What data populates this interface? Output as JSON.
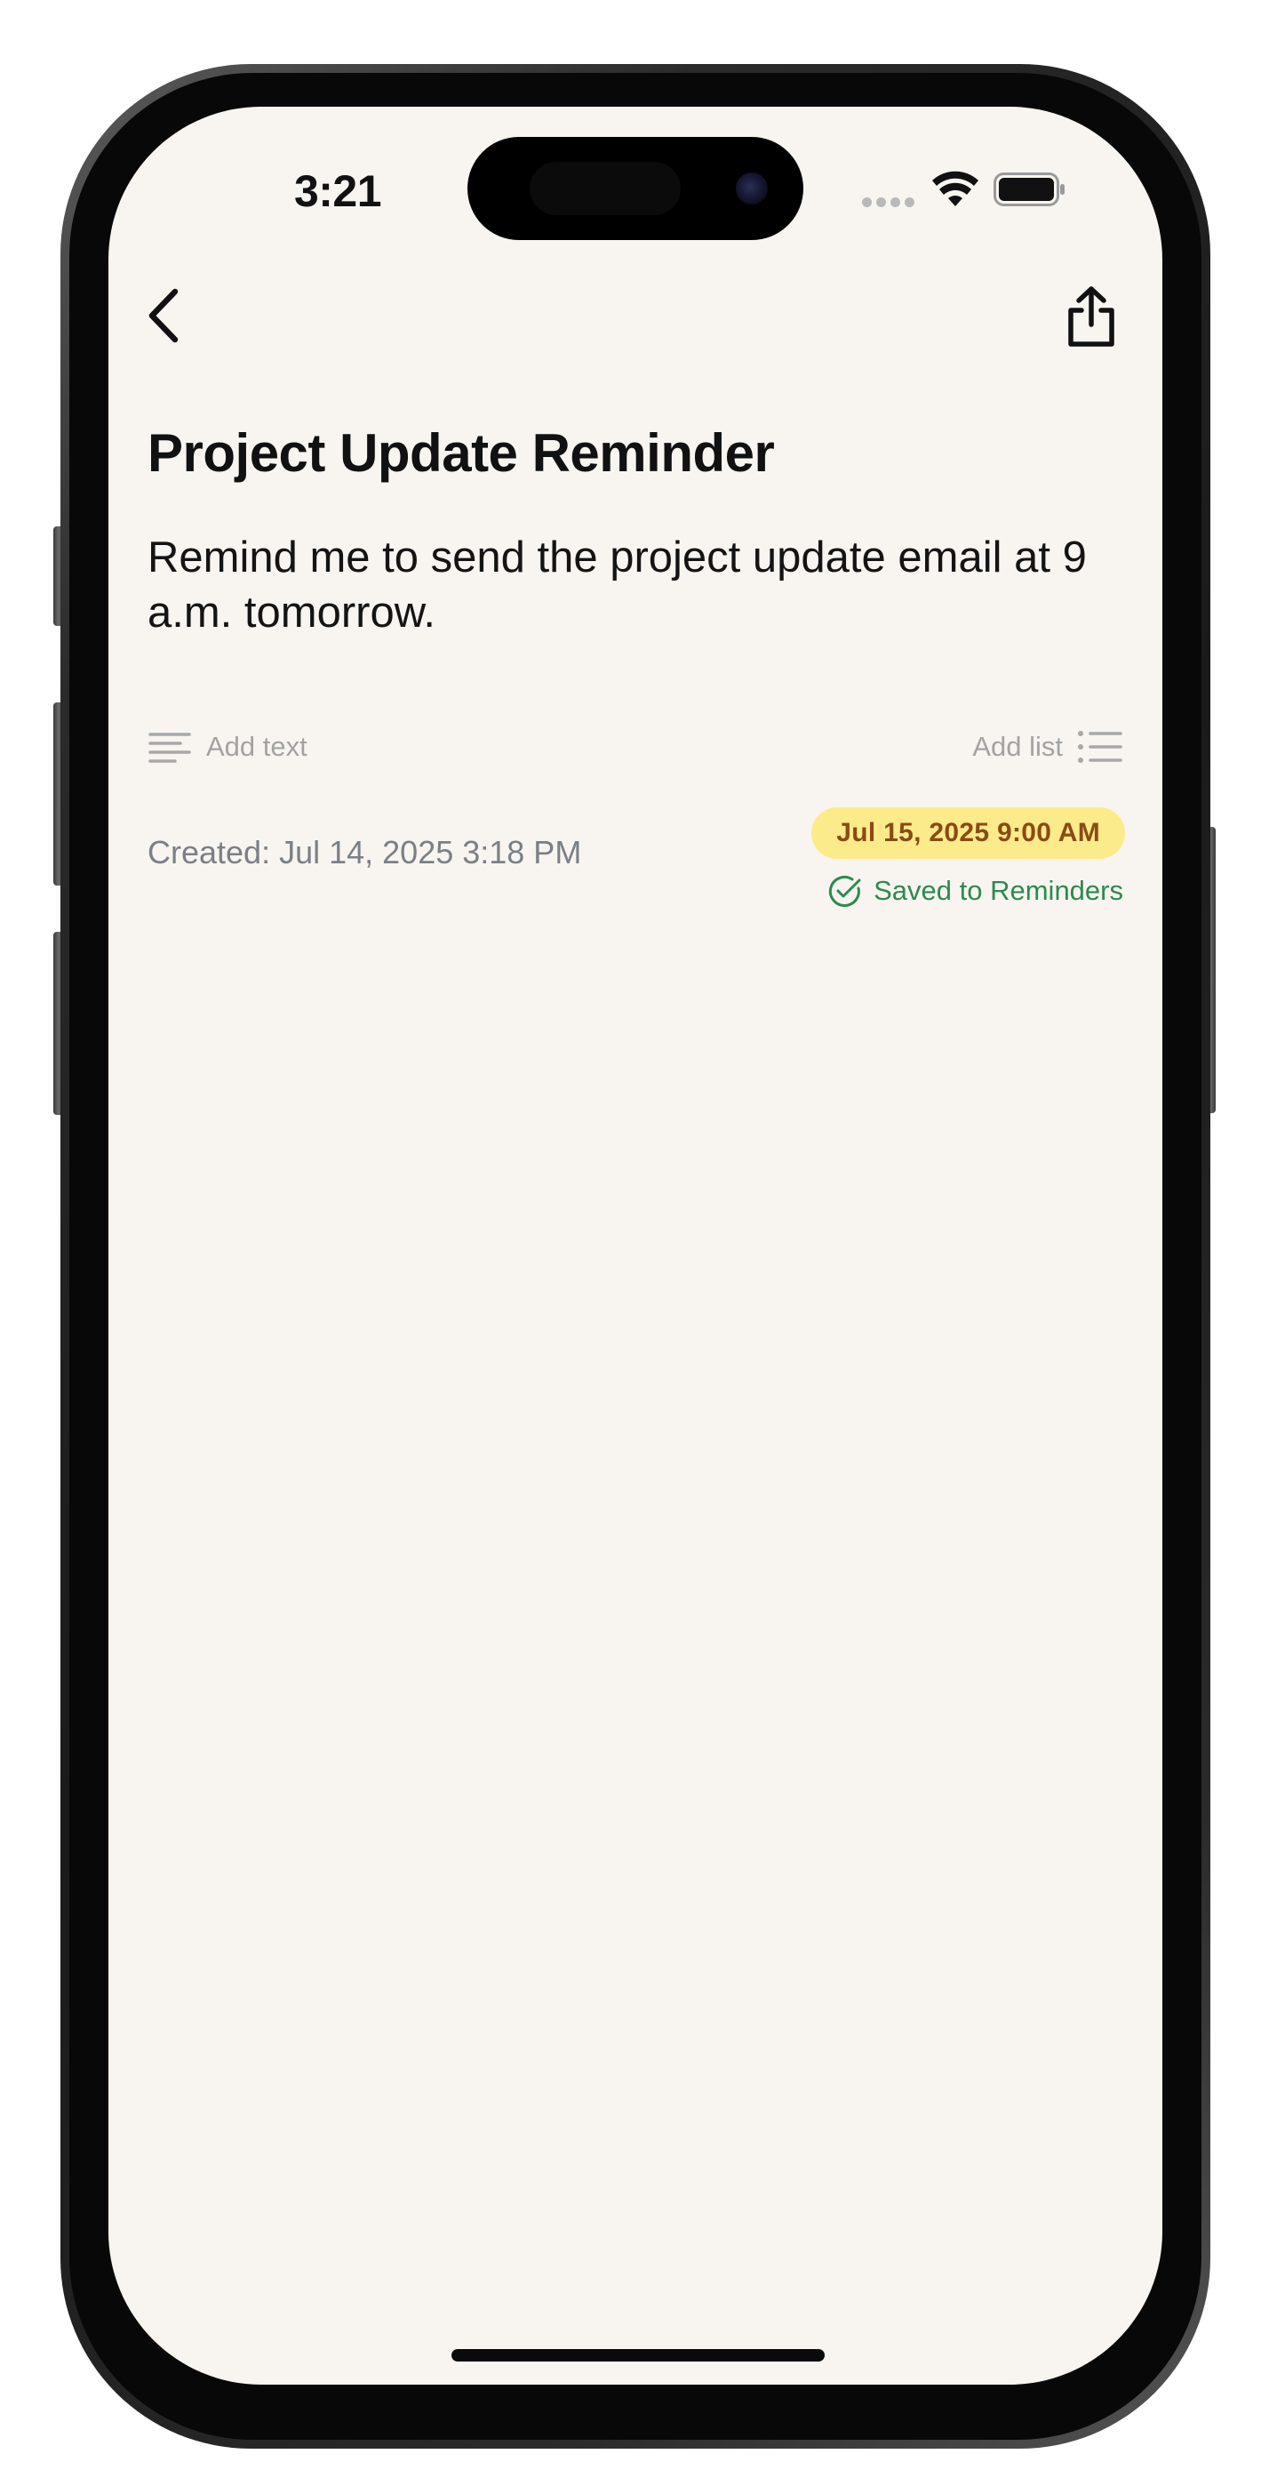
{
  "status_bar": {
    "time": "3:21",
    "icons": [
      "cellular-signal-icon",
      "wifi-icon",
      "battery-icon"
    ]
  },
  "nav": {
    "back_icon": "chevron-left-icon",
    "share_icon": "share-icon"
  },
  "note": {
    "title": "Project Update Reminder",
    "body": "Remind me to send the project update email at 9 a.m. tomorrow."
  },
  "toolbar": {
    "add_text_label": "Add text",
    "add_text_icon": "text-lines-icon",
    "add_list_label": "Add list",
    "add_list_icon": "bulleted-list-icon"
  },
  "meta": {
    "created": "Created: Jul 14, 2025 3:18 PM",
    "due_badge": "Jul 15, 2025 9:00 AM",
    "saved_status": "Saved to Reminders",
    "saved_icon": "checkmark-circle-icon"
  },
  "colors": {
    "screen_background": "#f8f5f0",
    "badge_background": "#fceb8b",
    "badge_text": "#8a4b14",
    "success_green": "#2d8a4f",
    "muted_text": "#a3a3a3",
    "secondary_text": "#7b7f86"
  }
}
